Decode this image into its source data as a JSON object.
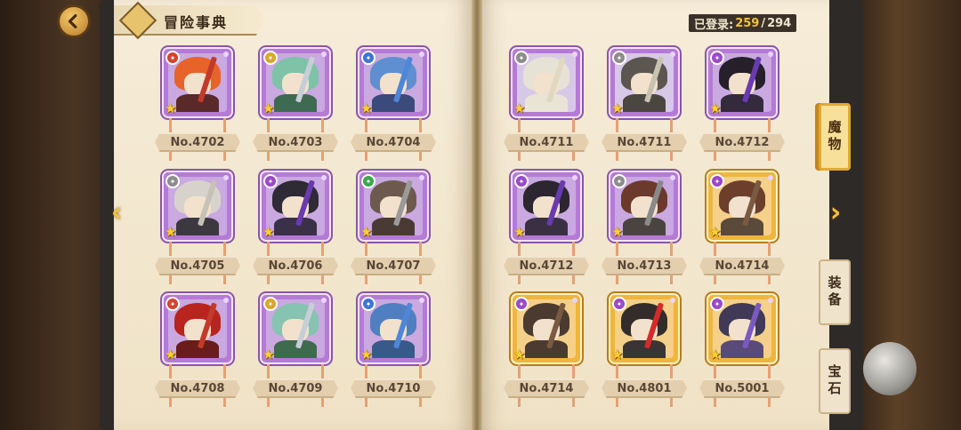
{
  "title": "冒险事典",
  "counter": {
    "label": "已登录:",
    "current": "259",
    "separator": "/",
    "total": "294"
  },
  "tabs": [
    {
      "label": "魔物",
      "active": true
    },
    {
      "label": "装备",
      "active": false
    },
    {
      "label": "宝石",
      "active": false
    }
  ],
  "cards": [
    {
      "number": "No.4702",
      "rarity": "purple",
      "element": "fire",
      "star": "★"
    },
    {
      "number": "No.4703",
      "rarity": "purple",
      "element": "light",
      "star": "★"
    },
    {
      "number": "No.4704",
      "rarity": "purple",
      "element": "water",
      "star": "★"
    },
    {
      "number": "No.4705",
      "rarity": "purple",
      "element": "neutral",
      "star": "★"
    },
    {
      "number": "No.4706",
      "rarity": "purple",
      "element": "dark",
      "star": "★"
    },
    {
      "number": "No.4707",
      "rarity": "purple",
      "element": "wind",
      "star": "★"
    },
    {
      "number": "No.4708",
      "rarity": "purple",
      "element": "fire",
      "star": "★"
    },
    {
      "number": "No.4709",
      "rarity": "purple",
      "element": "light",
      "star": "★"
    },
    {
      "number": "No.4710",
      "rarity": "purple",
      "element": "water",
      "star": "★"
    },
    {
      "number": "No.4711",
      "rarity": "purple",
      "element": "neutral",
      "star": "★"
    },
    {
      "number": "No.4711",
      "rarity": "purple",
      "element": "neutral",
      "star": "★"
    },
    {
      "number": "No.4712",
      "rarity": "purple",
      "element": "dark",
      "star": "★"
    },
    {
      "number": "No.4712",
      "rarity": "purple",
      "element": "dark",
      "star": "★"
    },
    {
      "number": "No.4713",
      "rarity": "purple",
      "element": "neutral",
      "star": "★"
    },
    {
      "number": "No.4714",
      "rarity": "gold",
      "element": "dark",
      "star": "★"
    },
    {
      "number": "No.4714",
      "rarity": "gold",
      "element": "dark",
      "star": "★"
    },
    {
      "number": "No.4801",
      "rarity": "gold",
      "element": "dark",
      "star": "★"
    },
    {
      "number": "No.5001",
      "rarity": "gold",
      "element": "dark",
      "star": "★"
    }
  ],
  "colors": {
    "accent": "#f4c23e",
    "purple_frame": "#b57ad6",
    "gold_frame": "#f0b53c"
  },
  "icons": {
    "back": "back-arrow-icon",
    "prev": "chevron-left-icon",
    "next": "chevron-right-icon"
  }
}
